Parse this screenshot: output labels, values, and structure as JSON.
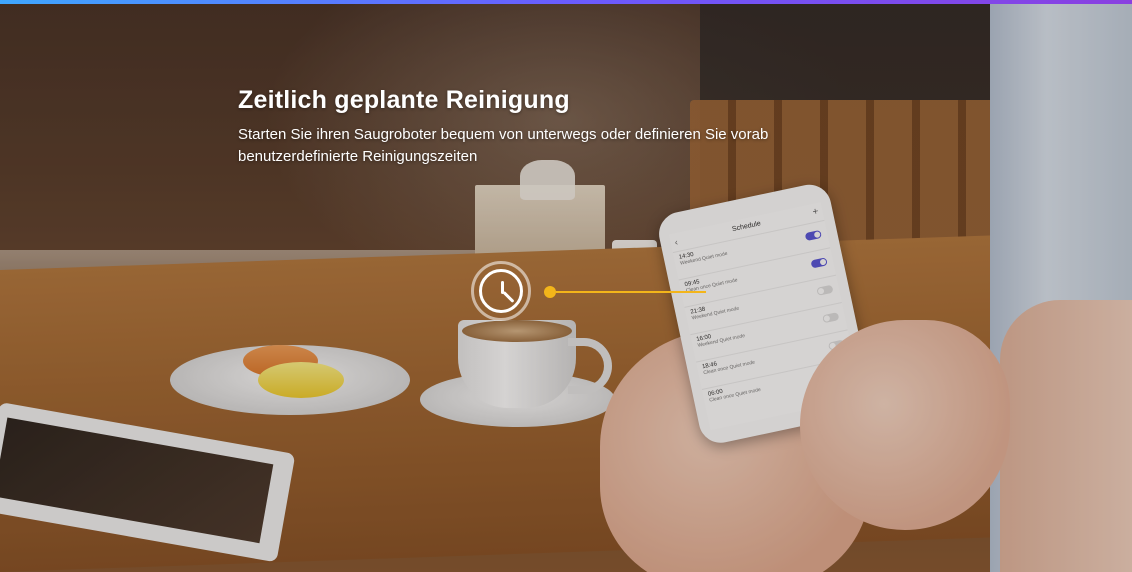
{
  "hero": {
    "headline": "Zeitlich geplante Reinigung",
    "subline": "Starten Sie ihren Saugroboter bequem von unterwegs oder definieren Sie vorab benutzerdefinierte Reinigungszeiten"
  },
  "phone": {
    "title": "Schedule",
    "schedules": [
      {
        "time": "14:30",
        "mode": "Weekend Quiet mode",
        "enabled": true
      },
      {
        "time": "09:45",
        "mode": "Clean once Quiet mode",
        "enabled": true
      },
      {
        "time": "21:38",
        "mode": "Weekend Quiet mode",
        "enabled": false
      },
      {
        "time": "16:00",
        "mode": "Weekend Quiet mode",
        "enabled": false
      },
      {
        "time": "18:46",
        "mode": "Clean once Quiet mode",
        "enabled": false
      },
      {
        "time": "06:00",
        "mode": "Clean once Quiet mode",
        "enabled": false
      }
    ]
  },
  "colors": {
    "accent": "#f3b51a",
    "toggle_on": "#5a57d8",
    "top_bar": "#6a5cff"
  },
  "icons": [
    "clock-icon",
    "back-arrow-icon",
    "plus-icon"
  ]
}
